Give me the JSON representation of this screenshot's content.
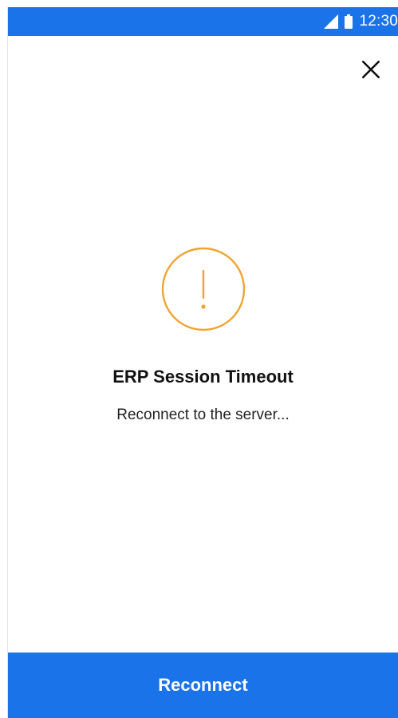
{
  "status_bar": {
    "time": "12:30",
    "icons": [
      "signal-icon",
      "battery-icon"
    ]
  },
  "header": {
    "close_icon": "close-icon"
  },
  "dialog": {
    "icon": "exclamation-circle-icon",
    "title": "ERP Session Timeout",
    "message": "Reconnect to the server..."
  },
  "footer": {
    "reconnect_label": "Reconnect"
  },
  "colors": {
    "primary": "#1a73e8",
    "warning": "#f0a431",
    "text": "#111111"
  }
}
